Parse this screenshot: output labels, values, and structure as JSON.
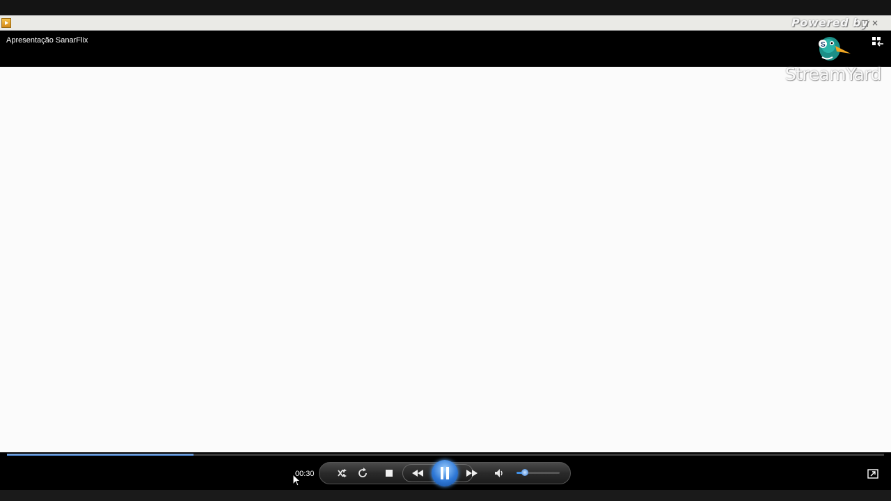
{
  "window": {
    "title": "",
    "watermark_top": "Powered by",
    "controls": "- □ ×"
  },
  "header": {
    "media_title": "Apresentação SanarFlix",
    "switch_icon": "switch-to-library-icon"
  },
  "overlay": {
    "brand": "StreamYard",
    "logo_icon": "streamyard-duck-logo"
  },
  "player": {
    "current_time": "00:30",
    "progress_fraction": 0.213,
    "volume_fraction": 0.2,
    "state": "playing",
    "icons": [
      "shuffle-icon",
      "repeat-icon",
      "stop-icon",
      "previous-icon",
      "pause-icon",
      "next-icon",
      "volume-icon",
      "fullscreen-icon"
    ]
  },
  "colors": {
    "accent": "#3f77c4",
    "titlebar": "#eaeae6",
    "video_background": "#fbfbfb",
    "chrome": "#000000"
  }
}
